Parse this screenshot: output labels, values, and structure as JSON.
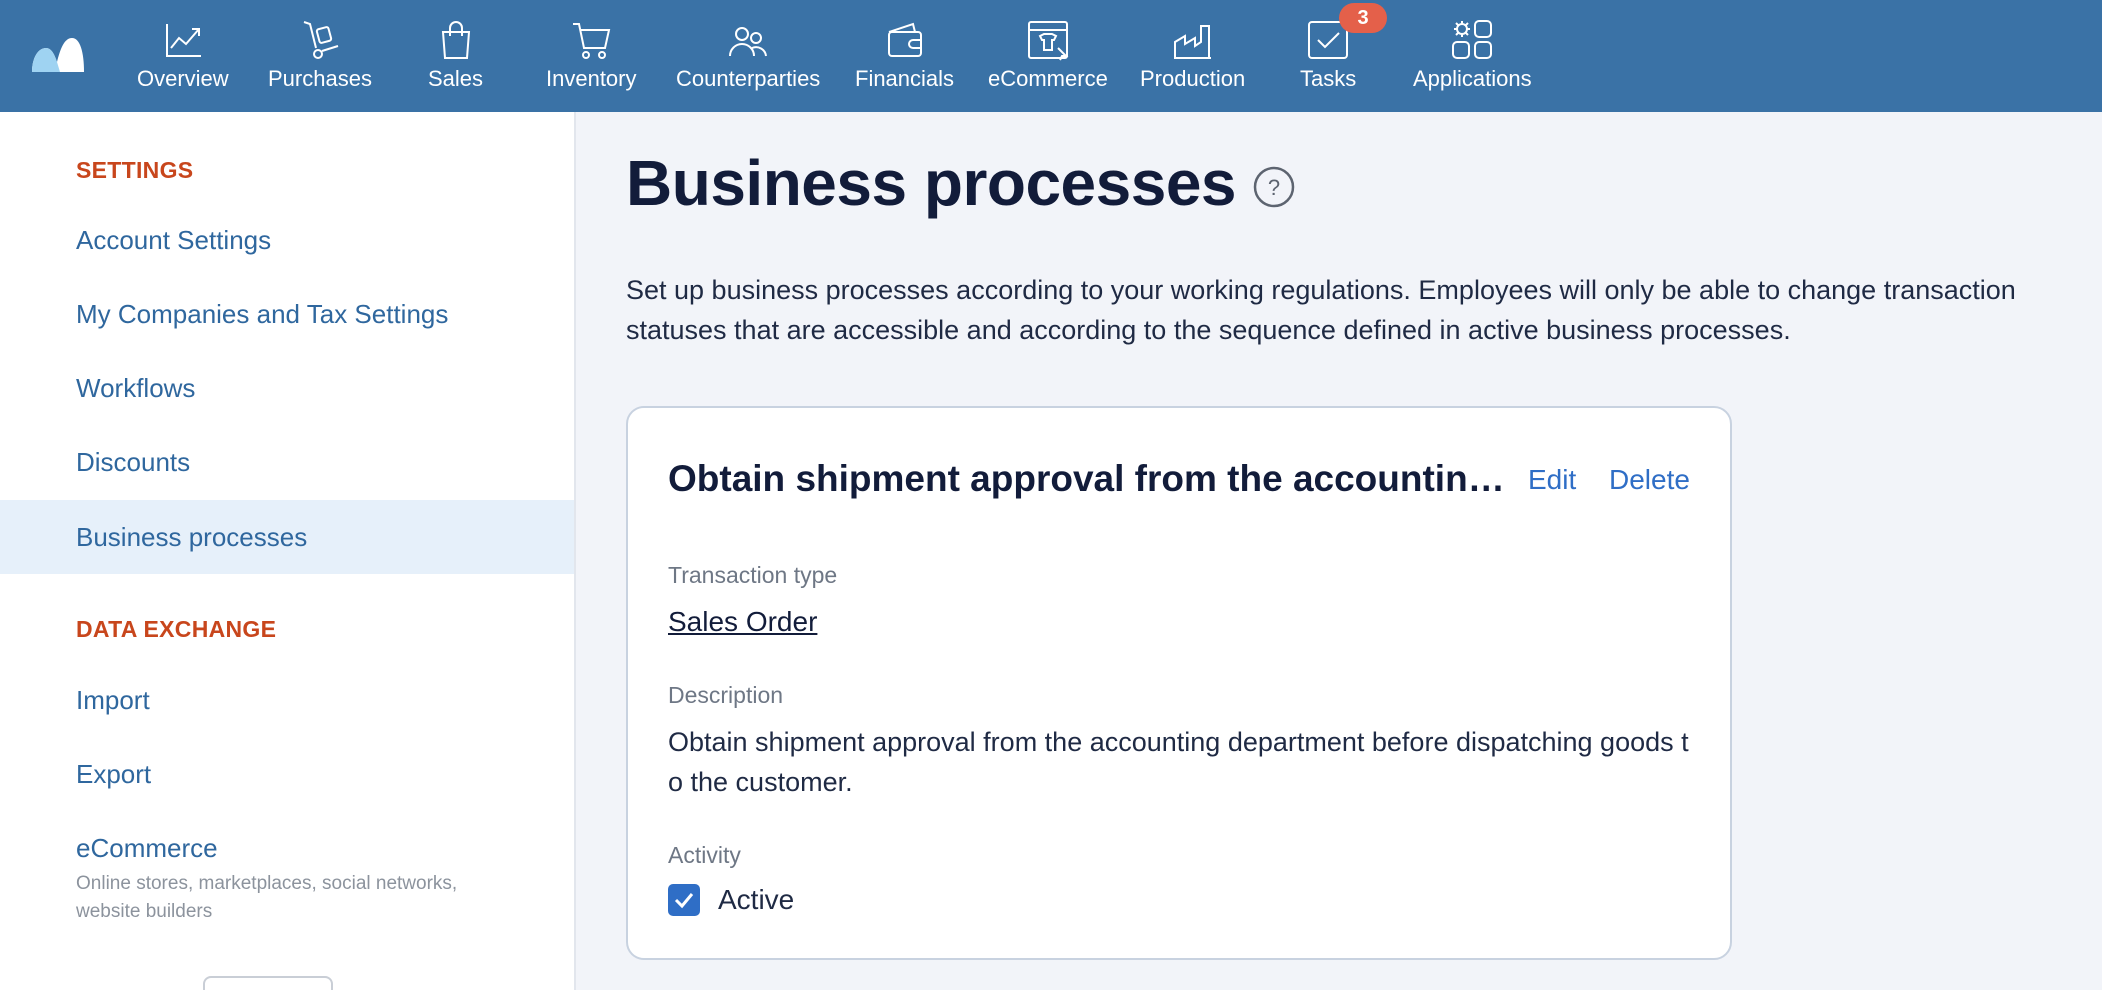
{
  "nav": {
    "items": [
      {
        "label": "Overview"
      },
      {
        "label": "Purchases"
      },
      {
        "label": "Sales"
      },
      {
        "label": "Inventory"
      },
      {
        "label": "Counterparties"
      },
      {
        "label": "Financials"
      },
      {
        "label": "eCommerce"
      },
      {
        "label": "Production"
      },
      {
        "label": "Tasks"
      },
      {
        "label": "Applications"
      }
    ],
    "tasks_badge": "3"
  },
  "sidebar": {
    "settings_heading": "SETTINGS",
    "settings_items": [
      {
        "label": "Account Settings"
      },
      {
        "label": "My Companies and Tax Settings"
      },
      {
        "label": "Workflows"
      },
      {
        "label": "Discounts"
      },
      {
        "label": "Business processes"
      }
    ],
    "data_exchange_heading": "DATA EXCHANGE",
    "data_exchange_items": [
      {
        "label": "Import"
      },
      {
        "label": "Export"
      },
      {
        "label": "eCommerce"
      }
    ],
    "ecommerce_subtext": "Online stores, marketplaces, social networks, website builders"
  },
  "main": {
    "title": "Business processes",
    "description": "Set up business processes according to your working regulations. Employees will only be able to change transaction statuses that are accessible and according to the sequence defined in active business processes."
  },
  "card": {
    "title": "Obtain shipment approval from the accounting department before dispatching goods to the customer.",
    "edit_label": "Edit",
    "delete_label": "Delete",
    "transaction_type_label": "Transaction type",
    "transaction_type_value": "Sales Order",
    "description_label": "Description",
    "description_value": "Obtain shipment approval from the accounting department before dispatching goods to the customer.",
    "activity_label": "Activity",
    "active_label": "Active",
    "active_checked": true
  },
  "colors": {
    "topbar": "#3a72a6",
    "accent_link": "#2f6ec6",
    "section_heading": "#c8461c",
    "badge": "#e4604a"
  }
}
